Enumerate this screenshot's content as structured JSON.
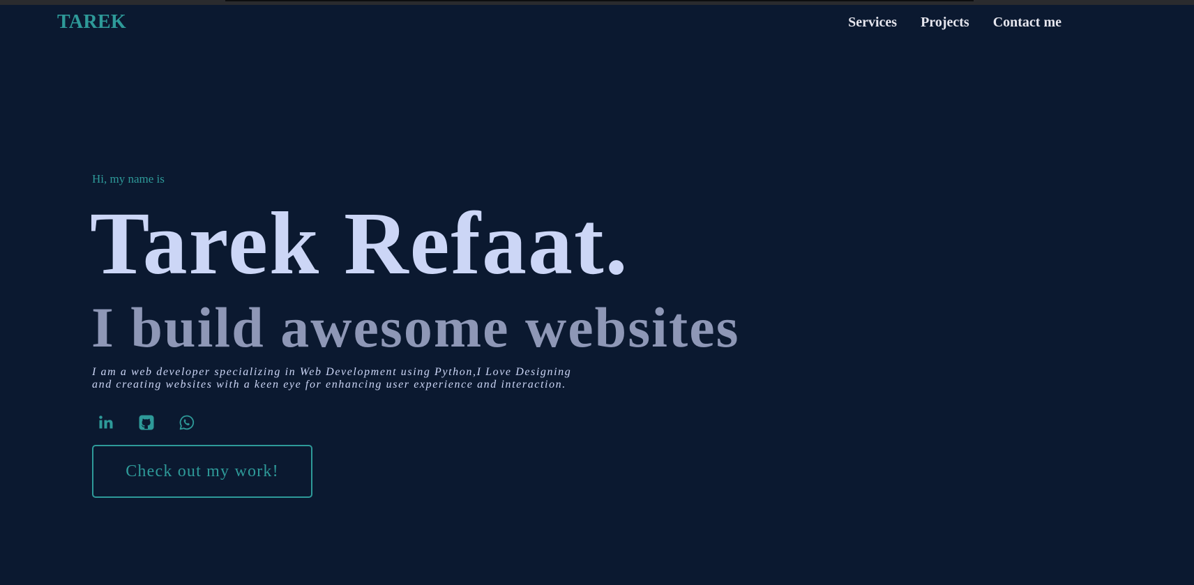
{
  "header": {
    "logo": "TAREK",
    "nav": [
      {
        "label": "Services"
      },
      {
        "label": "Projects"
      },
      {
        "label": "Contact me"
      }
    ]
  },
  "hero": {
    "greeting": "Hi, my name is",
    "name": "Tarek Refaat.",
    "tagline": "I build awesome websites",
    "bio": "I am a web developer specializing in Web Development using Python,I Love Designing and creating websites with a keen eye for enhancing user experience and interaction.",
    "socials": [
      {
        "icon": "linkedin-icon"
      },
      {
        "icon": "github-icon"
      },
      {
        "icon": "whatsapp-icon"
      }
    ],
    "cta_label": "Check out my work!"
  },
  "colors": {
    "background": "#0b1930",
    "accent": "#2e9a99",
    "heading": "#ccd6f6",
    "subheading": "#8e97b6",
    "nav_text": "#e6e6ee"
  }
}
